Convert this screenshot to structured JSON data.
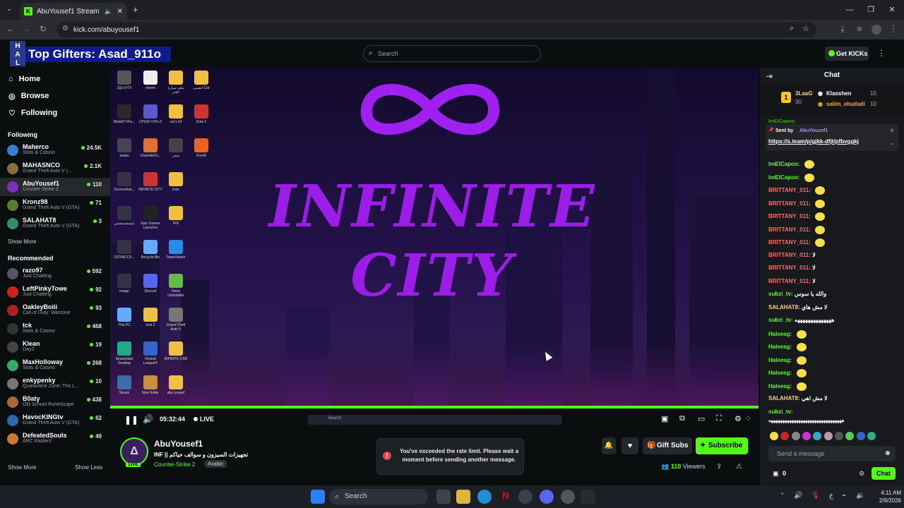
{
  "browser": {
    "tab_title": "AbuYousef1 Stream - Watc",
    "url": "kick.com/abuyousef1"
  },
  "overlay": {
    "top_gifters": "Top Gifters: Asad_911o"
  },
  "header": {
    "search_placeholder": "Search",
    "get_kicks": "Get KICKs"
  },
  "sidebar": {
    "nav": [
      {
        "label": "Home",
        "icon": "home-icon"
      },
      {
        "label": "Browse",
        "icon": "compass-icon"
      },
      {
        "label": "Following",
        "icon": "heart-icon"
      }
    ],
    "following_title": "Following",
    "following": [
      {
        "name": "Maherco",
        "game": "Slots & Casino",
        "viewers": "24.5K",
        "color": "#3a7bd5"
      },
      {
        "name": "MAHASNCO",
        "game": "Grand Theft Auto V (...",
        "viewers": "2.1K",
        "color": "#8a6d3b"
      },
      {
        "name": "AbuYousef1",
        "game": "Counter-Strike 2",
        "viewers": "110",
        "color": "#7b2fbf"
      },
      {
        "name": "Kronz98",
        "game": "Grand Theft Auto V (GTA)",
        "viewers": "71",
        "color": "#5a7a30"
      },
      {
        "name": "SALAHAT8",
        "game": "Grand Theft Auto V (GTA)",
        "viewers": "3",
        "color": "#2f8f6a"
      }
    ],
    "show_more": "Show More",
    "recommended_title": "Recommended",
    "recommended": [
      {
        "name": "razo97",
        "game": "Just Chatting",
        "viewers": "592",
        "color": "#556"
      },
      {
        "name": "LeftPinkyTowe",
        "game": "Just Chatting",
        "viewers": "92",
        "color": "#c22"
      },
      {
        "name": "OakleyBoiii",
        "game": "Call of Duty: Warzone",
        "viewers": "93",
        "color": "#a22"
      },
      {
        "name": "tck",
        "game": "Slots & Casino",
        "viewers": "468",
        "color": "#333"
      },
      {
        "name": "Klean",
        "game": "DayZ",
        "viewers": "19",
        "color": "#444"
      },
      {
        "name": "MaxHolloway",
        "game": "Slots & Casino",
        "viewers": "268",
        "color": "#3a6"
      },
      {
        "name": "enkypenky",
        "game": "Quarantine Zone: The L...",
        "viewers": "10",
        "color": "#777"
      },
      {
        "name": "B0aty",
        "game": "Old School RuneScape",
        "viewers": "438",
        "color": "#a63"
      },
      {
        "name": "HavocKINGtv",
        "game": "Grand Theft Auto V (GTA)",
        "viewers": "62",
        "color": "#36a"
      },
      {
        "name": "DefeatedSouls",
        "game": "ARC Raiders",
        "viewers": "49",
        "color": "#c73"
      }
    ],
    "show_more_bottom": "Show More",
    "show_less": "Show Less"
  },
  "video": {
    "logo_line1": "INFINITE",
    "logo_line2": "CITY",
    "desktop_icons": [
      "Zg1vVTX",
      "nteem",
      "ملف سيارة الفنر",
      "انقسي Car",
      "MedalTVFiv...",
      "CPUID CPU-Z",
      "car's inf",
      "Dota 2",
      "asdas",
      "ClownfishV...",
      "متجر",
      "FiveM",
      "Screenshot...",
      "INFINITE CITY",
      "Kick",
      "شسشسشس",
      "Epic Games Launcher",
      "IFN",
      "F07A9CC9...",
      "Recycle Bin",
      "TeamViewer",
      "image",
      "Discord",
      "Revo Uninstaller",
      "This PC",
      "kick 2",
      "Grand Theft Auto V",
      "Streamlabs Desktop",
      "Rocket League®",
      "INFINITE CAR",
      "Steam",
      "New folder",
      "abu yousef"
    ],
    "inner_taskbar_search": "Search"
  },
  "controls": {
    "time": "05:32:44",
    "live": "LIVE"
  },
  "stream_info": {
    "streamer": "AbuYousef1",
    "title": "INF || تجهيزات السيزون و سوالف حياكم",
    "category": "Counter-Strike 2",
    "tag": "Arabic",
    "live_badge": "LIVE",
    "gift_subs": "Gift Subs",
    "subscribe": "Subscribe",
    "viewers_count": "110",
    "viewers_label": "Viewers"
  },
  "toast": {
    "text": "You've exceeded the rate limit. Please wait a moment before sending another message."
  },
  "chat": {
    "title": "Chat",
    "leaderboard": [
      {
        "name": "3LaaG",
        "count": "30"
      },
      {
        "name": "Klasshen",
        "count": "10"
      },
      {
        "name": "salim_elsafadi",
        "count": "10"
      }
    ],
    "pinned_label": "Sent by",
    "pinned_by": "AbuYousef1",
    "pinned_link": "https://s.team/p/gjkk-dfjt/pfbvggkj",
    "hidden_name": "ImElCapoo:",
    "messages": [
      {
        "user": "ImElCapoo:",
        "text": "",
        "color": "#53fc18",
        "emote": true
      },
      {
        "user": "ImElCapoo:",
        "text": "",
        "color": "#53fc18",
        "emote": true
      },
      {
        "user": "BRITTANY_011:",
        "text": "",
        "color": "#ff6b6b",
        "emote": true
      },
      {
        "user": "BRITTANY_011:",
        "text": "",
        "color": "#ff6b6b",
        "emote": true
      },
      {
        "user": "BRITTANY_011:",
        "text": "",
        "color": "#ff6b6b",
        "emote": true
      },
      {
        "user": "BRITTANY_011:",
        "text": "",
        "color": "#ff6b6b",
        "emote": true
      },
      {
        "user": "BRITTANY_011:",
        "text": "",
        "color": "#ff6b6b",
        "emote": true
      },
      {
        "user": "BRITTANY_011:",
        "text": "لا",
        "color": "#ff6b6b",
        "emote": false
      },
      {
        "user": "BRITTANY_011:",
        "text": "لا",
        "color": "#ff6b6b",
        "emote": false
      },
      {
        "user": "BRITTANY_011:",
        "text": "لا",
        "color": "#ff6b6b",
        "emote": false
      },
      {
        "user": "subzi_tv:",
        "text": "والله يا سوس",
        "color": "#53fc18",
        "emote": false
      },
      {
        "user": "SALAHAT8:",
        "text": "لا مش هاي",
        "color": "#f5d08a",
        "emote": false
      },
      {
        "user": "subzi_tv:",
        "text": "ههههههههههههههه",
        "color": "#53fc18",
        "emote": false
      },
      {
        "user": "Haleesg:",
        "text": "",
        "color": "#53fc18",
        "emote": true
      },
      {
        "user": "Haleesg:",
        "text": "",
        "color": "#53fc18",
        "emote": true
      },
      {
        "user": "Haleesg:",
        "text": "",
        "color": "#53fc18",
        "emote": true
      },
      {
        "user": "Haleesg:",
        "text": "",
        "color": "#53fc18",
        "emote": true
      },
      {
        "user": "Haleesg:",
        "text": "",
        "color": "#53fc18",
        "emote": true
      },
      {
        "user": "SALAHAT8:",
        "text": "لا مش اهي",
        "color": "#f5d08a",
        "emote": false
      },
      {
        "user": "subzi_tv:",
        "text": "",
        "color": "#53fc18",
        "emote": false
      }
    ],
    "last_line": "ههههههههههههههههههههههههههههههههه",
    "input_placeholder": "Send a message",
    "kicks_count": "0",
    "chat_button": "Chat"
  },
  "taskbar": {
    "search": "Search",
    "time": "4:11 AM",
    "date": "2/9/2026",
    "lang": "ع"
  },
  "colors": {
    "kick_green": "#53fc18",
    "purple": "#a020f0"
  }
}
